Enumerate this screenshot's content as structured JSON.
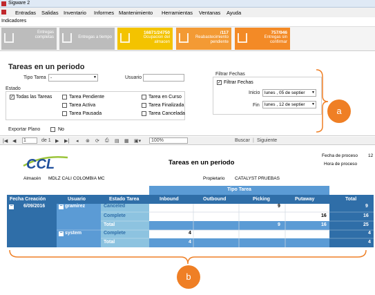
{
  "window": {
    "title": "Sigware 2"
  },
  "menu": [
    "Entradas",
    "Salidas",
    "Inventario",
    "Informes",
    "Mantenimiento",
    "Herramientas",
    "Ventanas",
    "Ayuda"
  ],
  "indicators_label": "Indicadores",
  "kpis": [
    {
      "value": "",
      "label": "Entregas completas",
      "color": "#bcbcbc"
    },
    {
      "value": "",
      "label": "Entregas a tiempo",
      "color": "#bcbcbc"
    },
    {
      "value": "16871/24750",
      "label": "Ocupacion del almacen",
      "color": "#f3c300"
    },
    {
      "value": "/117",
      "label": "Reabastecimiento pendiente",
      "color": "#f39a34"
    },
    {
      "value": "757/946",
      "label": "Entregas sin confirmar",
      "color": "#f38a26"
    }
  ],
  "form": {
    "title": "Tareas en un periodo",
    "tipo_tarea_label": "Tipo Tarea",
    "tipo_tarea_value": "-",
    "usuario_label": "Usuario",
    "usuario_value": "",
    "estado_label": "Estado",
    "estados": [
      {
        "label": "Todas las Tareas",
        "checked": true
      },
      {
        "label": "Tarea Pendiente",
        "checked": false
      },
      {
        "label": "Tarea en Curso",
        "checked": false
      },
      {
        "label": "Tarea Activa",
        "checked": false
      },
      {
        "label": "Tarea Finalizada",
        "checked": false
      },
      {
        "label": "Tarea Pausada",
        "checked": false
      },
      {
        "label": "Tarea Cancelada",
        "checked": false
      }
    ],
    "filtrar_group_label": "Filtrar Fechas",
    "filtrar_check_label": "Filtrar Fechas",
    "inicio_label": "Inicio",
    "inicio_value": "lunes , 05 de septier",
    "fin_label": "Fin",
    "fin_value": "lunes , 12 de septier",
    "exportar_label": "Exportar Plano",
    "exportar_no": "No"
  },
  "toolbar": {
    "page": "1",
    "of": "de 1",
    "zoom": "100%",
    "search": "Buscar",
    "next": "Siguiente"
  },
  "report": {
    "logo": "CCL",
    "title": "Tareas en un periodo",
    "fecha_label": "Fecha de proceso",
    "fecha_value": "12",
    "hora_label": "Hora de proceso",
    "almacen_label": "Almacén",
    "almacen_value": "MDLZ CALI COLOMBIA MC",
    "propietario_label": "Propietario",
    "propietario_value": "CATALYST PRUEBAS",
    "group_header": "Tipo Tarea",
    "headers": [
      "Fecha Creación",
      "Usuario",
      "Estado Tarea",
      "Inbound",
      "Outbound",
      "Picking",
      "Putaway",
      "Total"
    ],
    "date": "6/09/2016",
    "rows": [
      {
        "user": "gramirez",
        "estado": "Canceled",
        "inbound": "",
        "outbound": "",
        "picking": "9",
        "putaway": "",
        "total": "9"
      },
      {
        "user": "",
        "estado": "Complete",
        "inbound": "",
        "outbound": "",
        "picking": "",
        "putaway": "16",
        "total": "16"
      },
      {
        "user": "",
        "estado": "Total",
        "inbound": "",
        "outbound": "",
        "picking": "9",
        "putaway": "16",
        "total": "25"
      },
      {
        "user": "system",
        "estado": "Complete",
        "inbound": "4",
        "outbound": "",
        "picking": "",
        "putaway": "",
        "total": "4"
      },
      {
        "user": "",
        "estado": "Total",
        "inbound": "4",
        "outbound": "",
        "picking": "",
        "putaway": "",
        "total": "4"
      }
    ]
  },
  "callouts": {
    "a": "a",
    "b": "b"
  },
  "colors": {
    "header_dark": "#2f6ea8",
    "header_mid": "#5b9bd5",
    "header_light": "#8dc3e0",
    "accent": "#ef7f25"
  }
}
